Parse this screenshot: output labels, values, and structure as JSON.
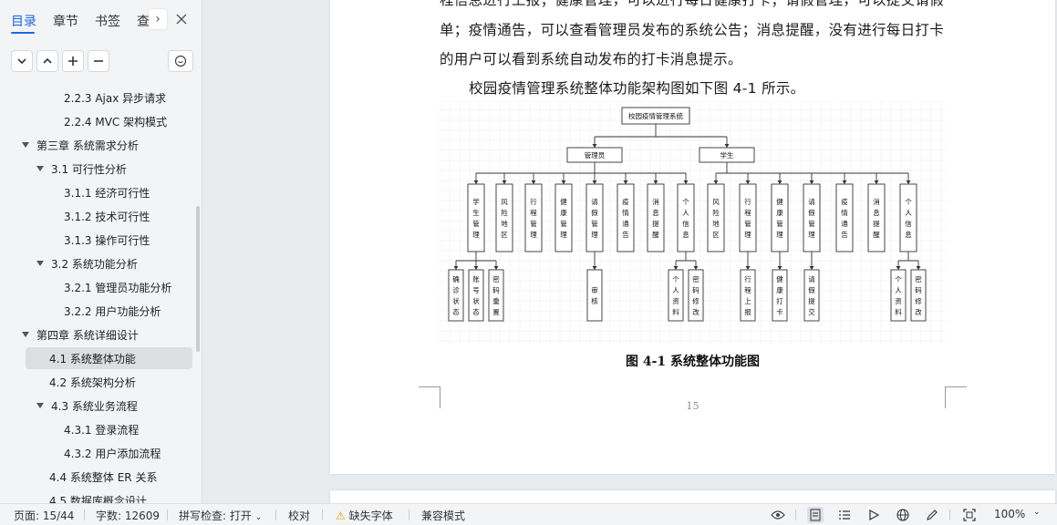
{
  "sidebar": {
    "tabs": [
      "目录",
      "章节",
      "书签",
      "查"
    ],
    "tab_more_glyph": "›",
    "close_glyph": "✕",
    "toc": [
      {
        "label": "2.2.3 Ajax 异步请求",
        "level": 3,
        "toggle": false
      },
      {
        "label": "2.2.4 MVC 架构模式",
        "level": 3,
        "toggle": false
      },
      {
        "label": "第三章  系统需求分析",
        "level": 1,
        "toggle": true
      },
      {
        "label": "3.1  可行性分析",
        "level": 2,
        "toggle": true
      },
      {
        "label": "3.1.1  经济可行性",
        "level": 3,
        "toggle": false
      },
      {
        "label": "3.1.2  技术可行性",
        "level": 3,
        "toggle": false
      },
      {
        "label": "3.1.3  操作可行性",
        "level": 3,
        "toggle": false
      },
      {
        "label": "3.2  系统功能分析",
        "level": 2,
        "toggle": true
      },
      {
        "label": "3.2.1  管理员功能分析",
        "level": 3,
        "toggle": false
      },
      {
        "label": "3.2.2  用户功能分析",
        "level": 3,
        "toggle": false
      },
      {
        "label": "第四章  系统详细设计",
        "level": 1,
        "toggle": true
      },
      {
        "label": "4.1  系统整体功能",
        "level": 2,
        "toggle": false,
        "selected": true
      },
      {
        "label": "4.2  系统架构分析",
        "level": 2,
        "toggle": false
      },
      {
        "label": "4.3  系统业务流程",
        "level": 2,
        "toggle": true
      },
      {
        "label": "4.3.1  登录流程",
        "level": 3,
        "toggle": false
      },
      {
        "label": "4.3.2  用户添加流程",
        "level": 3,
        "toggle": false
      },
      {
        "label": "4.4  系统整体 ER 关系",
        "level": 2,
        "toggle": false
      },
      {
        "label": "4.5  数据库概念设计",
        "level": 2,
        "toggle": false
      }
    ]
  },
  "document": {
    "line1": "程信息进行上报；健康管理，可以进行每日健康打卡；请假管理，可以提交请假",
    "line2": "单；疫情通告，可以查看管理员发布的系统公告；消息提醒，没有进行每日打卡",
    "line3": "的用户可以看到系统自动发布的打卡消息提示。",
    "line4": "校园疫情管理系统整体功能架构图如下图 4-1 所示。",
    "caption": "图 4-1  系统整体功能图",
    "page_number": "15",
    "diagram": {
      "root": "校园疫情管理系统",
      "admin": "管理员",
      "student": "学生",
      "modules": [
        "学生管理",
        "风险地区",
        "行程管理",
        "健康管理",
        "请假管理",
        "疫情通告",
        "消息提醒",
        "个人信息",
        "风险地区",
        "行程管理",
        "健康管理",
        "请假管理",
        "疫情通告",
        "消息提醒",
        "个人信息"
      ],
      "subs": [
        {
          "parent": 0,
          "labels": [
            "确诊状态",
            "账号状态",
            "密码重置"
          ]
        },
        {
          "parent": 4,
          "labels": [
            "审核"
          ]
        },
        {
          "parent": 7,
          "labels": [
            "个人资料",
            "密码修改"
          ]
        },
        {
          "parent": 9,
          "labels": [
            "行程上报"
          ]
        },
        {
          "parent": 10,
          "labels": [
            "健康打卡"
          ]
        },
        {
          "parent": 11,
          "labels": [
            "请假提交"
          ]
        },
        {
          "parent": 14,
          "labels": [
            "个人资料",
            "密码修改"
          ]
        }
      ]
    }
  },
  "statusbar": {
    "page": "页面: 15/44",
    "words": "字数: 12609",
    "spell": "拼写检查: 打开",
    "proof": "校对",
    "missing_font": "缺失字体",
    "compat": "兼容模式",
    "zoom": "100%"
  },
  "colors": {
    "accent": "#1a66e8",
    "warning": "#e8a100"
  }
}
